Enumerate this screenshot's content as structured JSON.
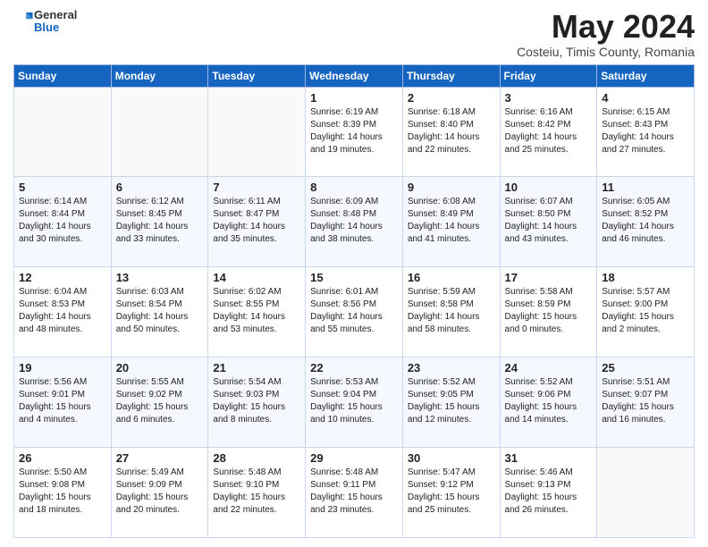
{
  "header": {
    "logo_general": "General",
    "logo_blue": "Blue",
    "month_title": "May 2024",
    "subtitle": "Costeiu, Timis County, Romania"
  },
  "days_of_week": [
    "Sunday",
    "Monday",
    "Tuesday",
    "Wednesday",
    "Thursday",
    "Friday",
    "Saturday"
  ],
  "weeks": [
    [
      {
        "day": "",
        "info": ""
      },
      {
        "day": "",
        "info": ""
      },
      {
        "day": "",
        "info": ""
      },
      {
        "day": "1",
        "info": "Sunrise: 6:19 AM\nSunset: 8:39 PM\nDaylight: 14 hours\nand 19 minutes."
      },
      {
        "day": "2",
        "info": "Sunrise: 6:18 AM\nSunset: 8:40 PM\nDaylight: 14 hours\nand 22 minutes."
      },
      {
        "day": "3",
        "info": "Sunrise: 6:16 AM\nSunset: 8:42 PM\nDaylight: 14 hours\nand 25 minutes."
      },
      {
        "day": "4",
        "info": "Sunrise: 6:15 AM\nSunset: 8:43 PM\nDaylight: 14 hours\nand 27 minutes."
      }
    ],
    [
      {
        "day": "5",
        "info": "Sunrise: 6:14 AM\nSunset: 8:44 PM\nDaylight: 14 hours\nand 30 minutes."
      },
      {
        "day": "6",
        "info": "Sunrise: 6:12 AM\nSunset: 8:45 PM\nDaylight: 14 hours\nand 33 minutes."
      },
      {
        "day": "7",
        "info": "Sunrise: 6:11 AM\nSunset: 8:47 PM\nDaylight: 14 hours\nand 35 minutes."
      },
      {
        "day": "8",
        "info": "Sunrise: 6:09 AM\nSunset: 8:48 PM\nDaylight: 14 hours\nand 38 minutes."
      },
      {
        "day": "9",
        "info": "Sunrise: 6:08 AM\nSunset: 8:49 PM\nDaylight: 14 hours\nand 41 minutes."
      },
      {
        "day": "10",
        "info": "Sunrise: 6:07 AM\nSunset: 8:50 PM\nDaylight: 14 hours\nand 43 minutes."
      },
      {
        "day": "11",
        "info": "Sunrise: 6:05 AM\nSunset: 8:52 PM\nDaylight: 14 hours\nand 46 minutes."
      }
    ],
    [
      {
        "day": "12",
        "info": "Sunrise: 6:04 AM\nSunset: 8:53 PM\nDaylight: 14 hours\nand 48 minutes."
      },
      {
        "day": "13",
        "info": "Sunrise: 6:03 AM\nSunset: 8:54 PM\nDaylight: 14 hours\nand 50 minutes."
      },
      {
        "day": "14",
        "info": "Sunrise: 6:02 AM\nSunset: 8:55 PM\nDaylight: 14 hours\nand 53 minutes."
      },
      {
        "day": "15",
        "info": "Sunrise: 6:01 AM\nSunset: 8:56 PM\nDaylight: 14 hours\nand 55 minutes."
      },
      {
        "day": "16",
        "info": "Sunrise: 5:59 AM\nSunset: 8:58 PM\nDaylight: 14 hours\nand 58 minutes."
      },
      {
        "day": "17",
        "info": "Sunrise: 5:58 AM\nSunset: 8:59 PM\nDaylight: 15 hours\nand 0 minutes."
      },
      {
        "day": "18",
        "info": "Sunrise: 5:57 AM\nSunset: 9:00 PM\nDaylight: 15 hours\nand 2 minutes."
      }
    ],
    [
      {
        "day": "19",
        "info": "Sunrise: 5:56 AM\nSunset: 9:01 PM\nDaylight: 15 hours\nand 4 minutes."
      },
      {
        "day": "20",
        "info": "Sunrise: 5:55 AM\nSunset: 9:02 PM\nDaylight: 15 hours\nand 6 minutes."
      },
      {
        "day": "21",
        "info": "Sunrise: 5:54 AM\nSunset: 9:03 PM\nDaylight: 15 hours\nand 8 minutes."
      },
      {
        "day": "22",
        "info": "Sunrise: 5:53 AM\nSunset: 9:04 PM\nDaylight: 15 hours\nand 10 minutes."
      },
      {
        "day": "23",
        "info": "Sunrise: 5:52 AM\nSunset: 9:05 PM\nDaylight: 15 hours\nand 12 minutes."
      },
      {
        "day": "24",
        "info": "Sunrise: 5:52 AM\nSunset: 9:06 PM\nDaylight: 15 hours\nand 14 minutes."
      },
      {
        "day": "25",
        "info": "Sunrise: 5:51 AM\nSunset: 9:07 PM\nDaylight: 15 hours\nand 16 minutes."
      }
    ],
    [
      {
        "day": "26",
        "info": "Sunrise: 5:50 AM\nSunset: 9:08 PM\nDaylight: 15 hours\nand 18 minutes."
      },
      {
        "day": "27",
        "info": "Sunrise: 5:49 AM\nSunset: 9:09 PM\nDaylight: 15 hours\nand 20 minutes."
      },
      {
        "day": "28",
        "info": "Sunrise: 5:48 AM\nSunset: 9:10 PM\nDaylight: 15 hours\nand 22 minutes."
      },
      {
        "day": "29",
        "info": "Sunrise: 5:48 AM\nSunset: 9:11 PM\nDaylight: 15 hours\nand 23 minutes."
      },
      {
        "day": "30",
        "info": "Sunrise: 5:47 AM\nSunset: 9:12 PM\nDaylight: 15 hours\nand 25 minutes."
      },
      {
        "day": "31",
        "info": "Sunrise: 5:46 AM\nSunset: 9:13 PM\nDaylight: 15 hours\nand 26 minutes."
      },
      {
        "day": "",
        "info": ""
      }
    ]
  ]
}
